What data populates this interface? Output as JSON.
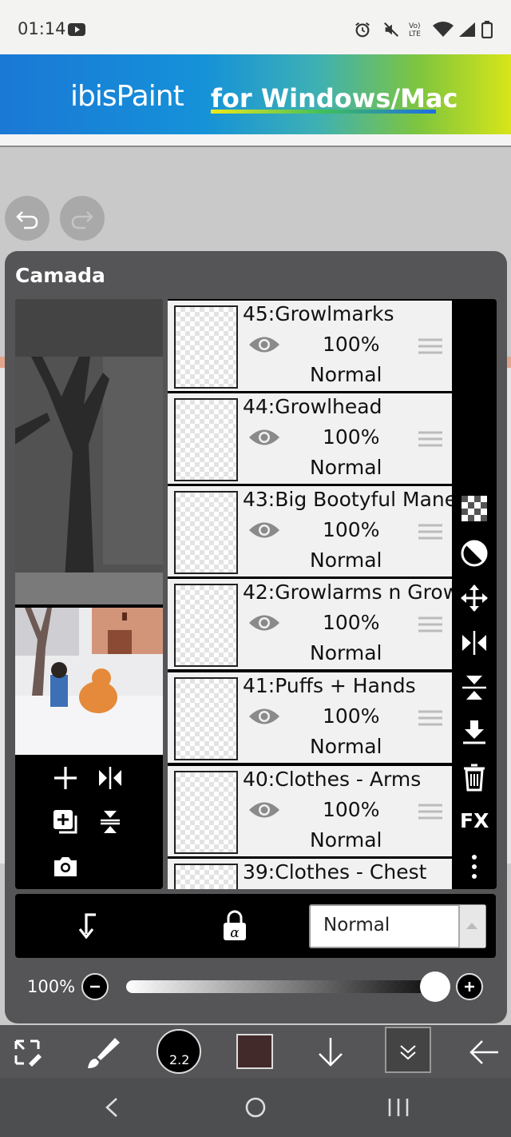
{
  "status_bar": {
    "time": "01:14",
    "network_label": "Vo) LTE"
  },
  "banner": {
    "brand": "ibisPaint",
    "tagline": "for Windows/Mac"
  },
  "panel": {
    "title": "Camada"
  },
  "layers": [
    {
      "name": "45:Growlmarks",
      "opacity": "100%",
      "blend": "Normal"
    },
    {
      "name": "44:Growlhead",
      "opacity": "100%",
      "blend": "Normal"
    },
    {
      "name": "43:Big Bootyful Mane",
      "opacity": "100%",
      "blend": "Normal"
    },
    {
      "name": "42:Growlarms n Grow",
      "opacity": "100%",
      "blend": "Normal"
    },
    {
      "name": "41:Puffs + Hands",
      "opacity": "100%",
      "blend": "Normal"
    },
    {
      "name": "40:Clothes - Arms",
      "opacity": "100%",
      "blend": "Normal"
    },
    {
      "name": "39:Clothes - Chest",
      "opacity": "",
      "blend": ""
    }
  ],
  "tools": {
    "fx_label": "FX"
  },
  "blend_select": {
    "value": "Normal"
  },
  "opacity_slider": {
    "label": "100%",
    "value": 1.0
  },
  "toolbar": {
    "brush_size": "2.2",
    "color": "#432a2a"
  }
}
